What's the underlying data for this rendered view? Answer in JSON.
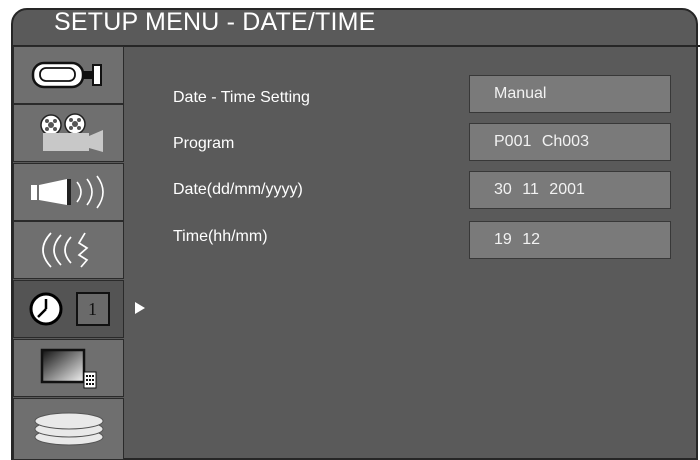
{
  "header": {
    "title": "SETUP MENU - DATE/TIME"
  },
  "sidebar": {
    "items": [
      {
        "icon": "video-camera-icon"
      },
      {
        "icon": "film-projector-icon"
      },
      {
        "icon": "speaker-sound-icon"
      },
      {
        "icon": "audio-waves-icon"
      },
      {
        "icon": "clock-icon",
        "badge": "1"
      },
      {
        "icon": "tv-monitor-icon"
      },
      {
        "icon": "disc-stack-icon"
      }
    ],
    "active_index": 4
  },
  "settings": [
    {
      "label": "Date - Time Setting",
      "value": "Manual"
    },
    {
      "label": "Program",
      "value": "P001 Ch003"
    },
    {
      "label": "Date(dd/mm/yyyy)",
      "value": "30 11 2001"
    },
    {
      "label": "Time(hh/mm)",
      "value": "19 12"
    }
  ],
  "colors": {
    "panel_bg": "#5a5a5a",
    "sidebar_item_bg": "#6f6f6f",
    "value_box_bg": "#7a7a7a",
    "text": "#ffffff"
  }
}
